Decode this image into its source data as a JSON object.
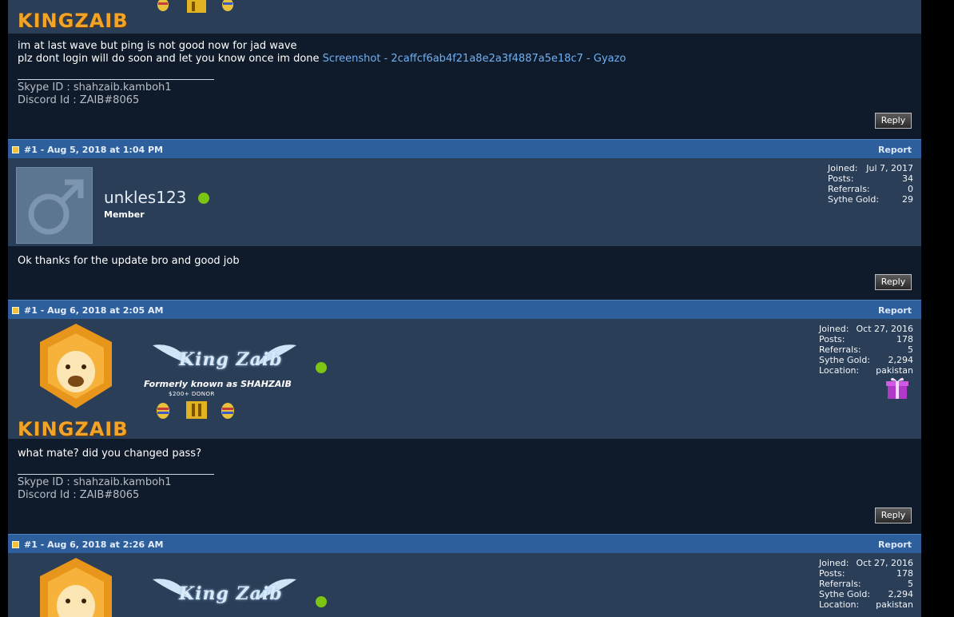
{
  "post0": {
    "username_logo_text": "KINGZAIB",
    "message_line1": "im at last wave but ping is not good now for jad wave",
    "message_line2_prefix": "plz dont login will do soon and let you know once im done ",
    "message_link": "Screenshot - 2caffcf6ab4f21a8e2a3f4887a5e18c7 - Gyazo",
    "sig_skype": "Skype ID : shahzaib.kamboh1",
    "sig_discord": "Discord Id : ZAIB#8065",
    "reply": "Reply"
  },
  "post1": {
    "permalink": "#1 - Aug 5, 2018 at 1:04 PM",
    "report": "Report",
    "username": "unkles123",
    "usertitle": "Member",
    "stats": [
      {
        "k": "Joined:",
        "v": "Jul 7, 2017"
      },
      {
        "k": "Posts:",
        "v": "34"
      },
      {
        "k": "Referrals:",
        "v": "0"
      },
      {
        "k": "Sythe Gold:",
        "v": "29"
      }
    ],
    "message": "Ok thanks for the update bro and good job",
    "reply": "Reply"
  },
  "post2": {
    "permalink": "#1 - Aug 6, 2018 at 2:05 AM",
    "report": "Report",
    "username_wordmark": "King Zaib",
    "former": "Formerly known as SHAHZAIB",
    "donor": "$200+ DONOR",
    "logo_text": "KINGZAIB",
    "stats": [
      {
        "k": "Joined:",
        "v": "Oct 27, 2016"
      },
      {
        "k": "Posts:",
        "v": "178"
      },
      {
        "k": "Referrals:",
        "v": "5"
      },
      {
        "k": "Sythe Gold:",
        "v": "2,294"
      },
      {
        "k": "Location:",
        "v": "pakistan"
      }
    ],
    "message": "what mate? did you changed pass?",
    "sig_skype": "Skype ID : shahzaib.kamboh1",
    "sig_discord": "Discord Id : ZAIB#8065",
    "reply": "Reply"
  },
  "post3": {
    "permalink": "#1 - Aug 6, 2018 at 2:26 AM",
    "report": "Report",
    "username_wordmark": "King Zaib",
    "stats": [
      {
        "k": "Joined:",
        "v": "Oct 27, 2016"
      },
      {
        "k": "Posts:",
        "v": "178"
      },
      {
        "k": "Referrals:",
        "v": "5"
      },
      {
        "k": "Sythe Gold:",
        "v": "2,294"
      },
      {
        "k": "Location:",
        "v": "pakistan"
      }
    ]
  },
  "colors": {
    "post_bar": "#2d5f9c",
    "user_area": "#2b3e57",
    "message_area": "#0f1b2b",
    "link": "#6fb0f5",
    "online": "#7cc513"
  }
}
